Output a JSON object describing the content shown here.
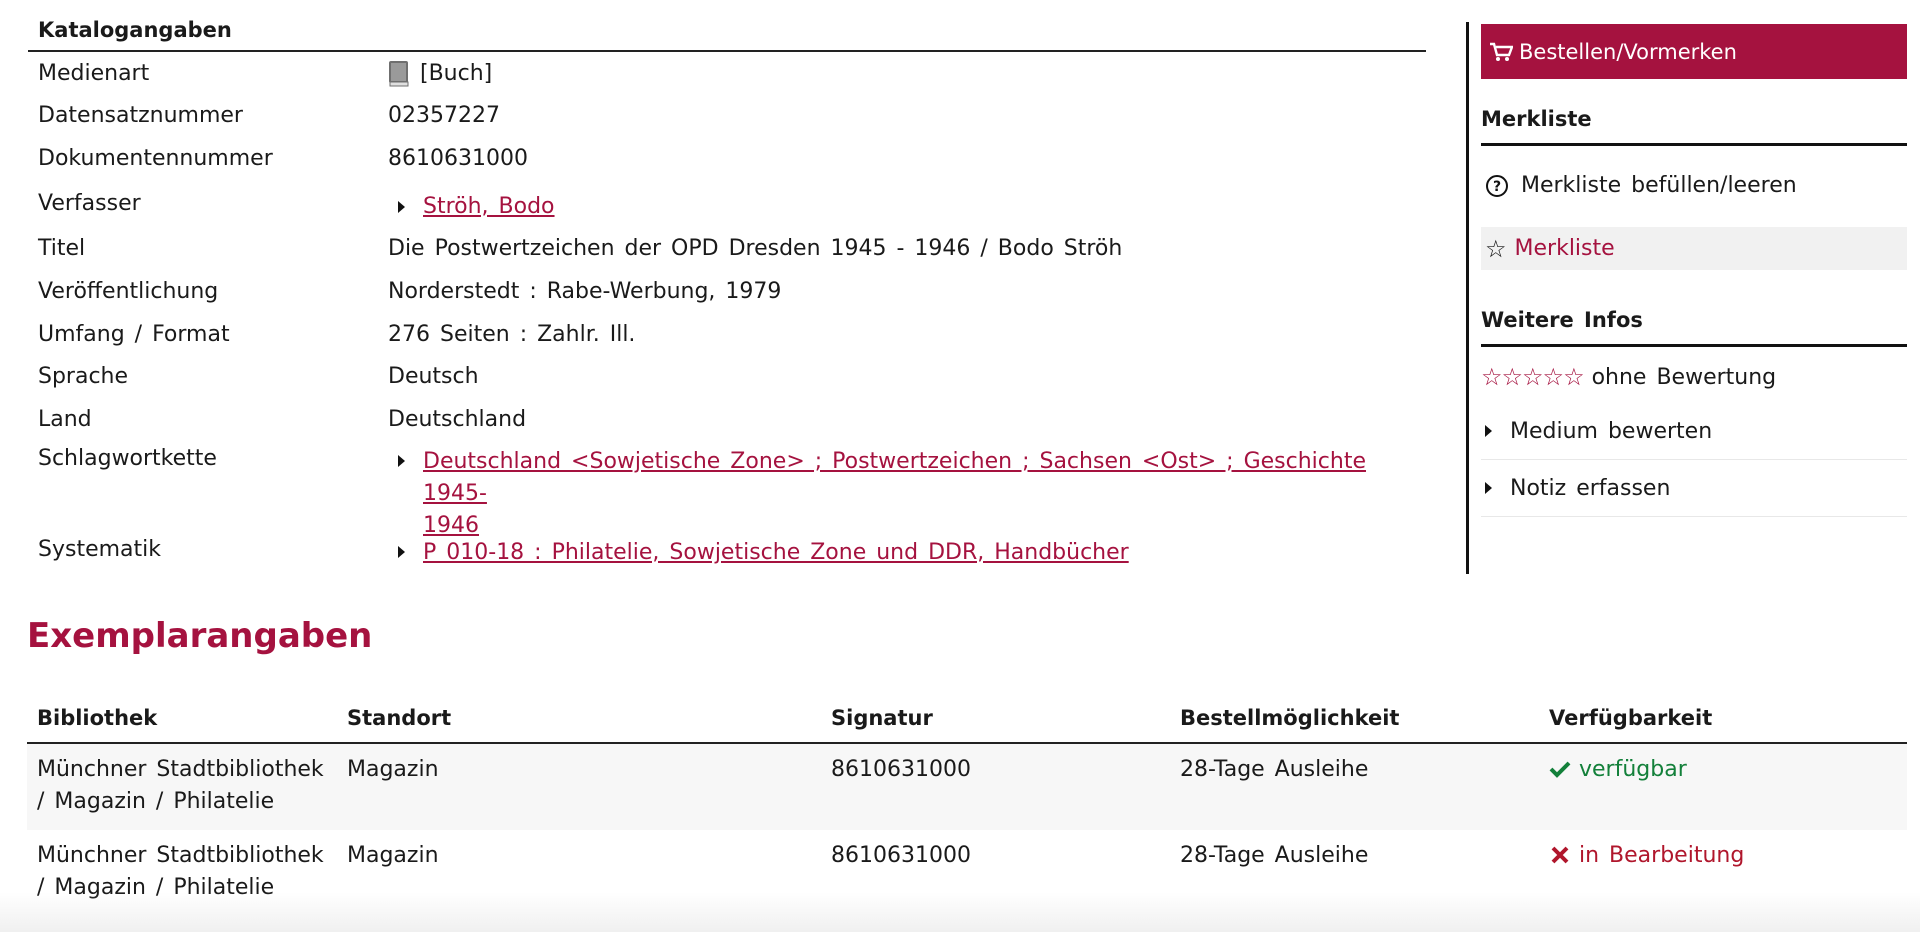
{
  "catalog": {
    "heading": "Katalogangaben",
    "rows": {
      "medienart": {
        "label": "Medienart",
        "value": "[Buch]"
      },
      "datensatz": {
        "label": "Datensatznummer",
        "value": "02357227"
      },
      "dokument": {
        "label": "Dokumentennummer",
        "value": "8610631000"
      },
      "verfasser": {
        "label": "Verfasser",
        "value": "Ströh, Bodo"
      },
      "titel": {
        "label": "Titel",
        "value": "Die Postwertzeichen der OPD Dresden 1945 - 1946 / Bodo Ströh"
      },
      "veroeffentlichung": {
        "label": "Veröffentlichung",
        "value": "Norderstedt : Rabe-Werbung, 1979"
      },
      "umfang": {
        "label": "Umfang / Format",
        "value": "276 Seiten : Zahlr. Ill."
      },
      "sprache": {
        "label": "Sprache",
        "value": "Deutsch"
      },
      "land": {
        "label": "Land",
        "value": "Deutschland"
      },
      "schlagwort": {
        "label": "Schlagwortkette",
        "value_line1": "Deutschland <Sowjetische Zone> ; Postwertzeichen ; Sachsen <Ost> ; Geschichte 1945-",
        "value_line2": "1946"
      },
      "systematik": {
        "label": "Systematik",
        "value": "P 010-18 : Philatelie, Sowjetische Zone und DDR, Handbücher"
      }
    }
  },
  "sidebar": {
    "order_button": "Bestellen/Vormerken",
    "merkliste_heading": "Merkliste",
    "merkliste_toggle": "Merkliste befüllen/leeren",
    "merkliste_link": "Merkliste",
    "infos_heading": "Weitere Infos",
    "rating_stars": "☆☆☆☆☆",
    "rating_text": "ohne Bewertung",
    "rate_item": "Medium bewerten",
    "note_item": "Notiz erfassen"
  },
  "exemplar": {
    "title": "Exemplarangaben",
    "headers": [
      "Bibliothek",
      "Standort",
      "Signatur",
      "Bestellmöglichkeit",
      "Verfügbarkeit"
    ],
    "rows": [
      {
        "bibliothek_l1": "Münchner Stadtbibliothek",
        "bibliothek_l2": "/ Magazin / Philatelie",
        "standort": "Magazin",
        "signatur": "8610631000",
        "bestellung": "28-Tage Ausleihe",
        "status": "verfügbar"
      },
      {
        "bibliothek_l1": "Münchner Stadtbibliothek",
        "bibliothek_l2": "/ Magazin / Philatelie",
        "standort": "Magazin",
        "signatur": "8610631000",
        "bestellung": "28-Tage Ausleihe",
        "status": "in Bearbeitung"
      }
    ]
  },
  "colors": {
    "accent": "#a5123f",
    "available": "#13803a",
    "unavailable": "#b0162c"
  }
}
